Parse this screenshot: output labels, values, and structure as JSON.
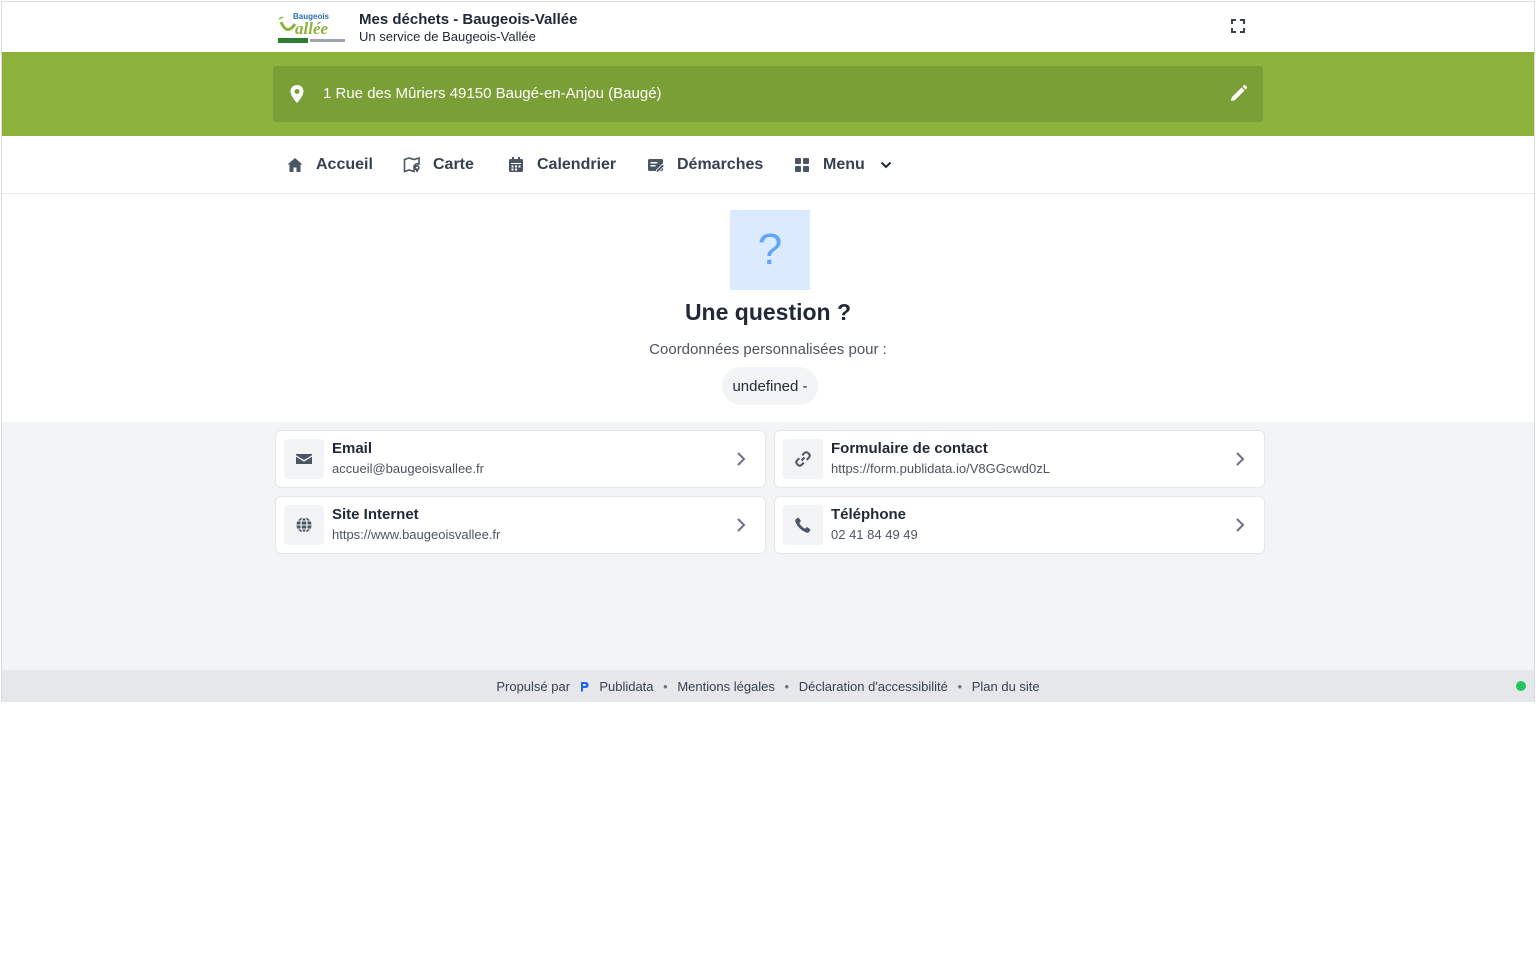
{
  "header": {
    "title": "Mes déchets - Baugeois-Vallée",
    "subtitle": "Un service de Baugeois-Vallée",
    "logo_text": "Baugeois Vallée"
  },
  "address": {
    "text": "1 Rue des Mûriers 49150 Baugé-en-Anjou (Baugé)"
  },
  "nav": {
    "items": [
      {
        "label": "Accueil",
        "icon": "home-icon"
      },
      {
        "label": "Carte",
        "icon": "map-icon"
      },
      {
        "label": "Calendrier",
        "icon": "calendar-icon"
      },
      {
        "label": "Démarches",
        "icon": "edit-form-icon"
      },
      {
        "label": "Menu",
        "icon": "grid-icon"
      }
    ]
  },
  "hero": {
    "icon_glyph": "?",
    "title": "Une question ?",
    "subtitle": "Coordonnées personnalisées pour :",
    "chip": "undefined -"
  },
  "contacts": [
    {
      "title": "Email",
      "value": "accueil@baugeoisvallee.fr",
      "icon": "envelope-icon"
    },
    {
      "title": "Formulaire de contact",
      "value": "https://form.publidata.io/V8GGcwd0zL",
      "icon": "link-icon"
    },
    {
      "title": "Site Internet",
      "value": "https://www.baugeoisvallee.fr",
      "icon": "globe-icon"
    },
    {
      "title": "Téléphone",
      "value": "02 41 84 49 49",
      "icon": "phone-icon"
    }
  ],
  "footer": {
    "powered_by": "Propulsé par",
    "brand": "Publidata",
    "links": [
      "Mentions légales",
      "Déclaration d'accessibilité",
      "Plan du site"
    ],
    "separator": "•"
  },
  "colors": {
    "brand_green": "#8db33c",
    "address_bar": "#7a9f36",
    "question_bg": "#dbeafe",
    "question_fg": "#60a5fa",
    "status": "#22c55e"
  }
}
